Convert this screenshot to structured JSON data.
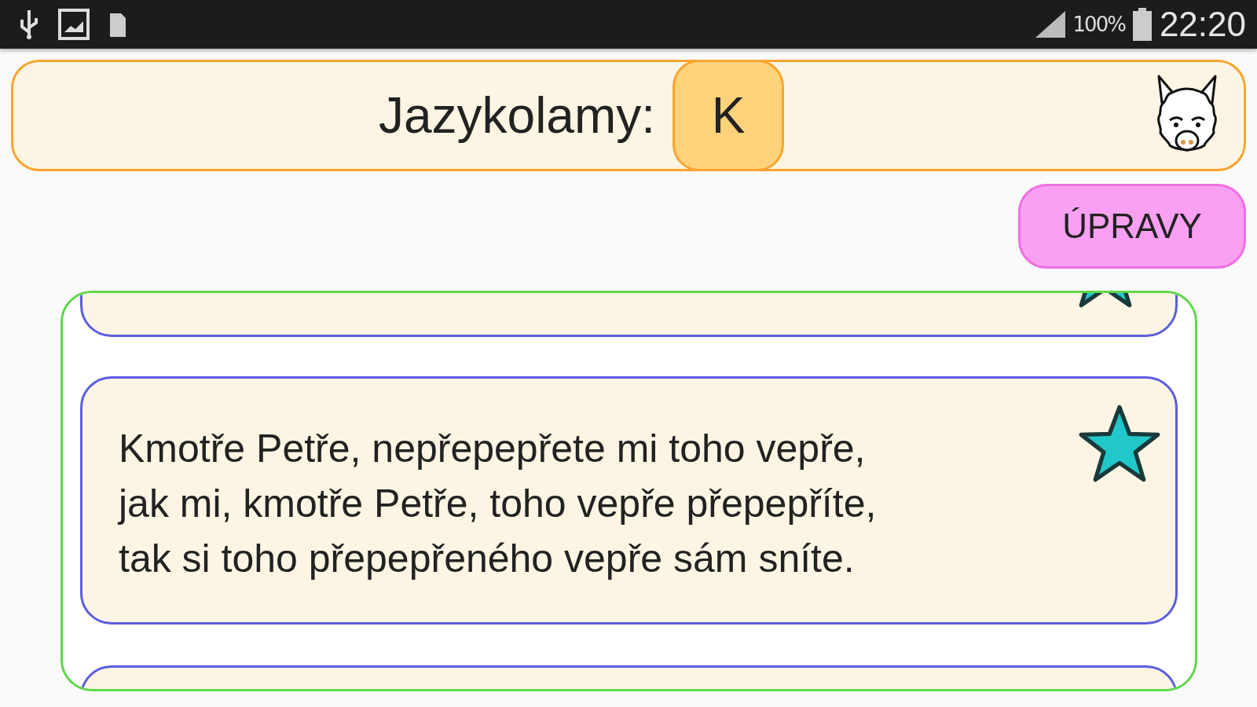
{
  "status_bar": {
    "battery": "100%",
    "time": "22:20"
  },
  "header": {
    "title": "Jazykolamy:",
    "letter": "K"
  },
  "edit_button": "ÚPRAVY",
  "cards": [
    {
      "kind": "cut_top",
      "favorite": true
    },
    {
      "kind": "full",
      "text": "Kmotře Petře, nepřepepřete mi toho vepře,\njak mi, kmotře Petře, toho vepře přepepříte,\ntak si toho přepepřeného vepře sám sníte.",
      "favorite": true
    },
    {
      "kind": "cut_bottom"
    }
  ]
}
